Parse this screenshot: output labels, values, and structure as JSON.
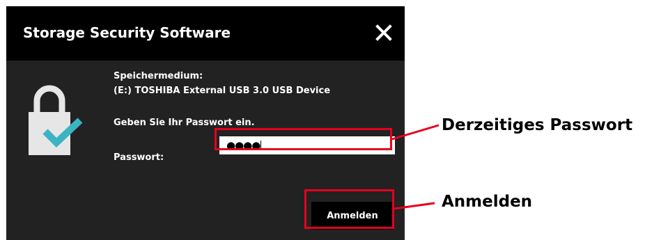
{
  "dialog": {
    "title": "Storage Security Software",
    "close_icon": "close-icon",
    "storage_label": "Speichermedium:",
    "device_name": "(E:) TOSHIBA External USB 3.0 USB Device",
    "instruction": "Geben Sie Ihr Passwort ein.",
    "password_label": "Passwort:",
    "password_value": "●●●●",
    "login_label": "Anmelden",
    "lock_icon": "lock-check-icon"
  },
  "annotations": {
    "password_callout": "Derzeitiges Passwort",
    "login_callout": "Anmelden",
    "highlight_color": "#e6001e"
  },
  "colors": {
    "titlebar": "#000000",
    "dialog_body": "#222222",
    "check_teal": "#3bb3c3",
    "lock_gray": "#e6e6e6"
  }
}
